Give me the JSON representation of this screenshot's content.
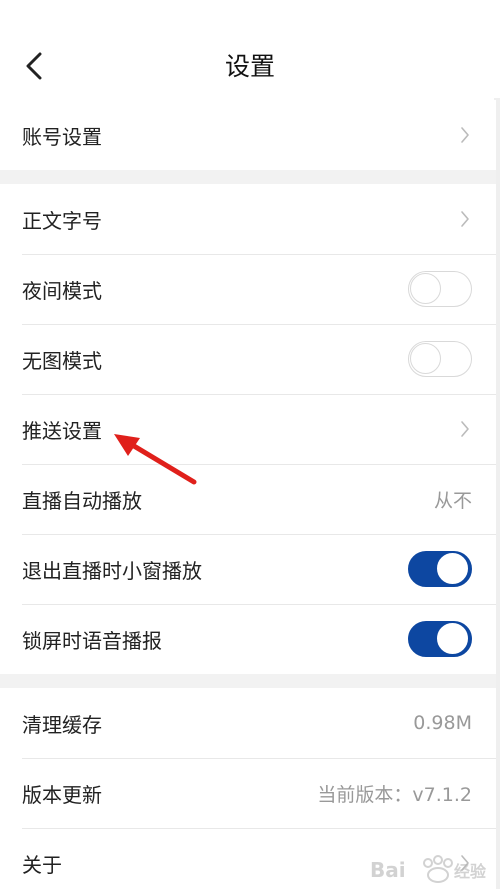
{
  "header": {
    "title": "设置"
  },
  "icons": {
    "back": "chevron-left-icon",
    "chevron": "chevron-right-icon"
  },
  "colors": {
    "toggle_on": "#0d47a1",
    "annotation_arrow": "#e0201b"
  },
  "section1": {
    "account": {
      "label": "账号设置"
    }
  },
  "section2": {
    "font_size": {
      "label": "正文字号"
    },
    "night_mode": {
      "label": "夜间模式",
      "on": false
    },
    "no_image_mode": {
      "label": "无图模式",
      "on": false
    },
    "push_settings": {
      "label": "推送设置"
    },
    "live_autoplay": {
      "label": "直播自动播放",
      "value": "从不"
    },
    "live_mini_window": {
      "label": "退出直播时小窗播放",
      "on": true
    },
    "lockscreen_voice": {
      "label": "锁屏时语音播报",
      "on": true
    }
  },
  "section3": {
    "clear_cache": {
      "label": "清理缓存",
      "value": "0.98M"
    },
    "version_update": {
      "label": "版本更新",
      "value": "当前版本：v7.1.2"
    },
    "about": {
      "label": "关于"
    }
  }
}
